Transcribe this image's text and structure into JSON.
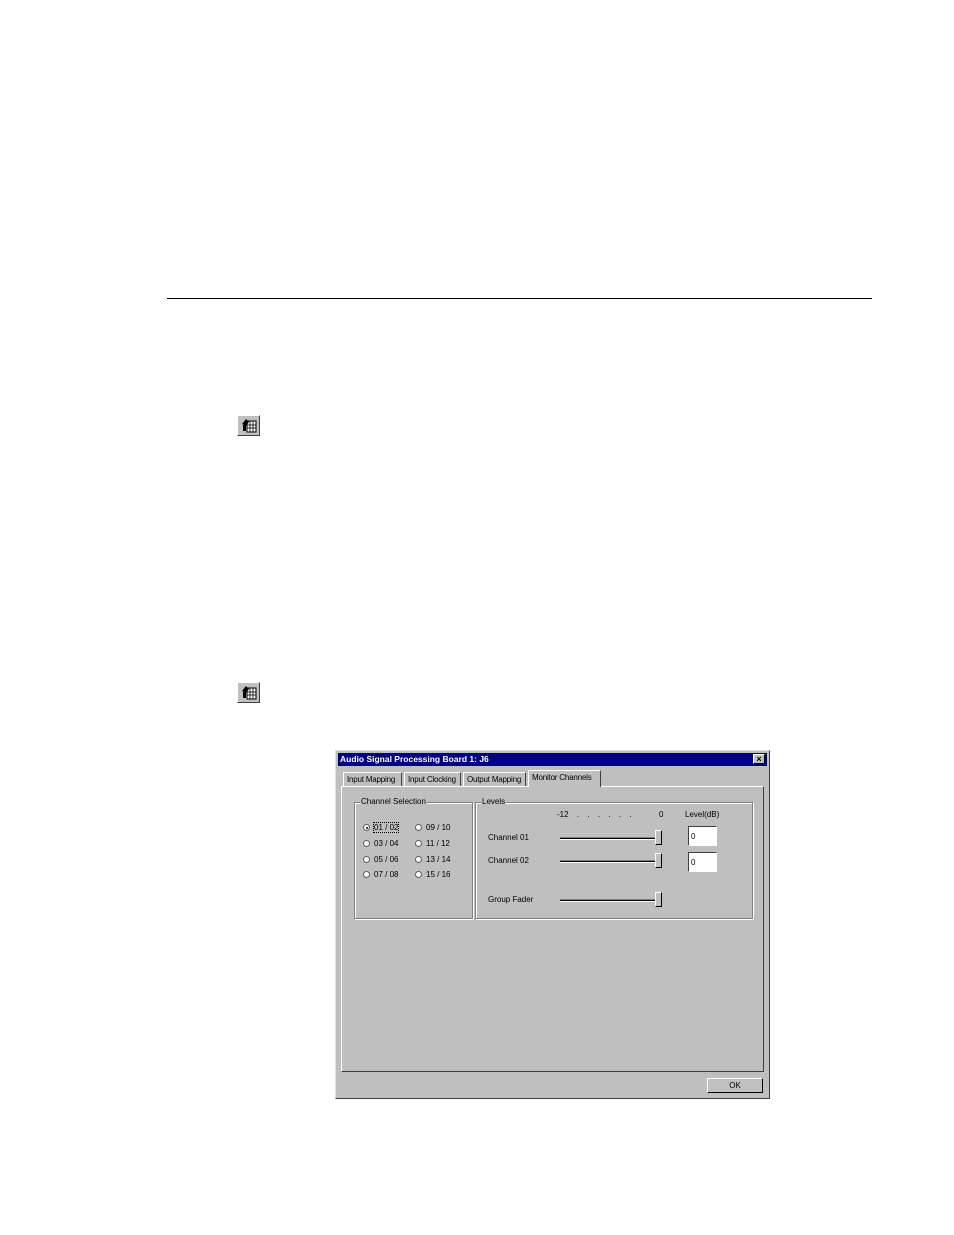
{
  "dialog": {
    "title": "Audio Signal Processing Board 1: J6",
    "close_glyph": "×",
    "tabs": [
      {
        "label": "Input Mapping"
      },
      {
        "label": "Input Clocking"
      },
      {
        "label": "Output Mapping"
      },
      {
        "label": "Monitor Channels",
        "active": true
      }
    ],
    "channel_selection": {
      "label": "Channel Selection",
      "options": [
        {
          "label": "01 / 02",
          "checked": true
        },
        {
          "label": "03 / 04"
        },
        {
          "label": "05 / 06"
        },
        {
          "label": "07 / 08"
        },
        {
          "label": "09 / 10"
        },
        {
          "label": "11 / 12"
        },
        {
          "label": "13 / 14"
        },
        {
          "label": "15 / 16"
        }
      ]
    },
    "levels": {
      "label": "Levels",
      "scale_min": "-12",
      "scale_dots": ". . . . . .",
      "scale_max": "0",
      "level_header": "Level(dB)",
      "channels": [
        {
          "label": "Channel 01",
          "value": "0",
          "level": 1.0
        },
        {
          "label": "Channel 02",
          "value": "0",
          "level": 1.0
        }
      ],
      "group_fader": {
        "label": "Group Fader",
        "level": 1.0
      }
    },
    "ok_label": "OK"
  },
  "icons": [
    "tool-icon",
    "tool-icon"
  ]
}
